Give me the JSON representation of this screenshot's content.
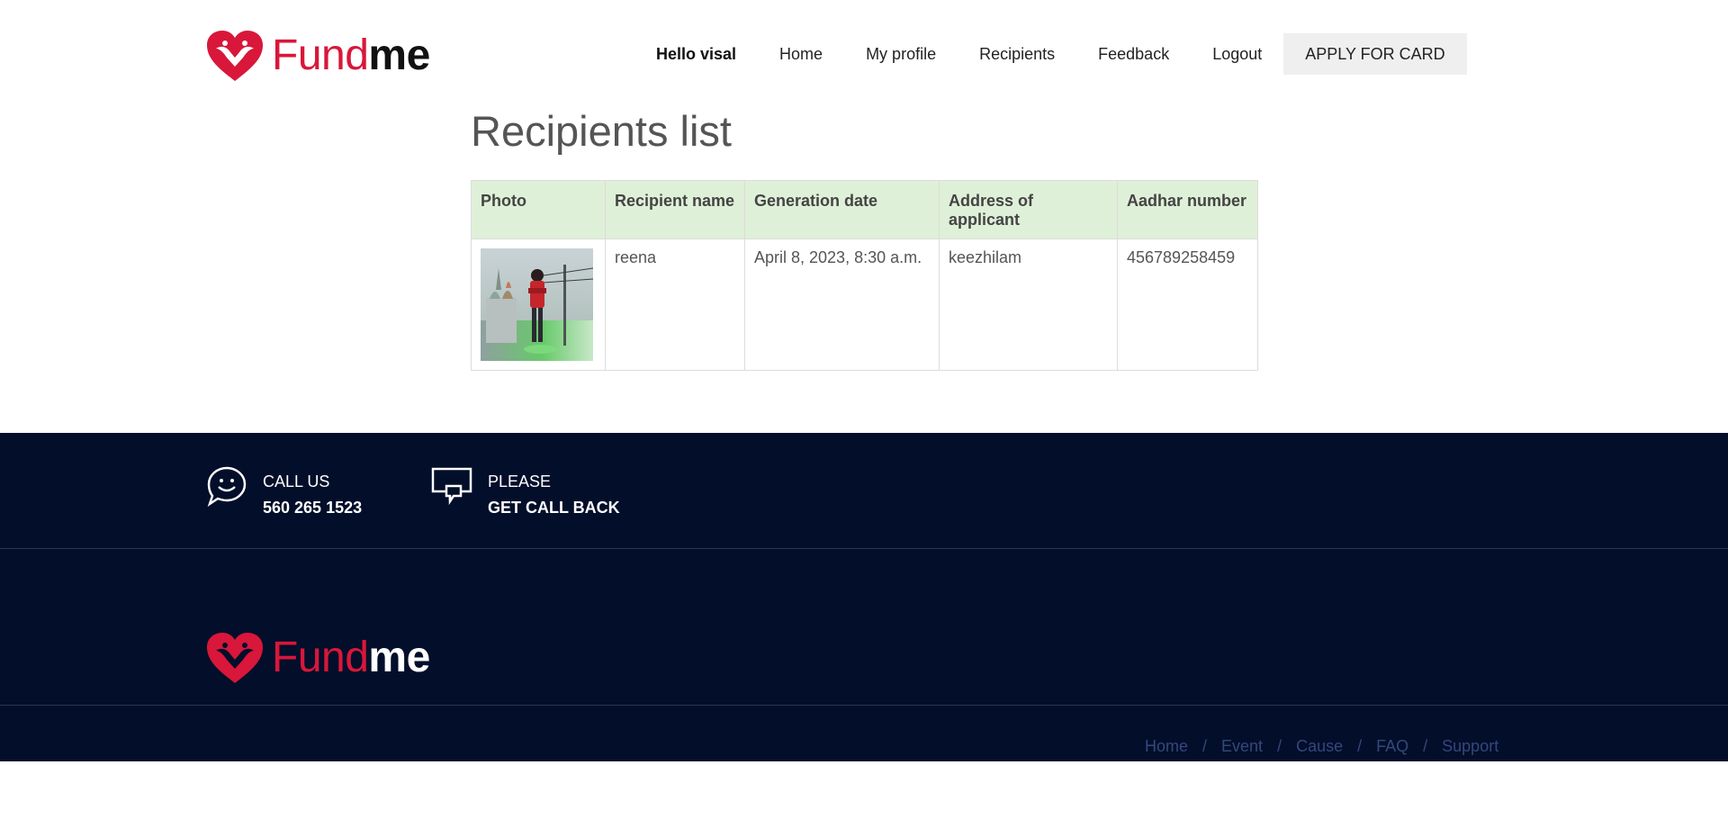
{
  "brand": {
    "name_part1": "Fund",
    "name_part2": "me"
  },
  "nav": {
    "greeting": "Hello visal",
    "items": [
      {
        "label": "Home"
      },
      {
        "label": "My profile"
      },
      {
        "label": "Recipients"
      },
      {
        "label": "Feedback"
      },
      {
        "label": "Logout"
      }
    ],
    "apply_label": "APPLY FOR CARD"
  },
  "main": {
    "title": "Recipients list",
    "table": {
      "headers": [
        "Photo",
        "Recipient name",
        "Generation date",
        "Address of applicant",
        "Aadhar number"
      ],
      "rows": [
        {
          "recipient_name": "reena",
          "generation_date": "April 8, 2023, 8:30 a.m.",
          "address": "keezhilam",
          "aadhar": "456789258459"
        }
      ]
    }
  },
  "footer": {
    "call": {
      "line1": "CALL US",
      "line2": "560 265 1523"
    },
    "callback": {
      "line1": "PLEASE",
      "line2": "GET CALL BACK"
    },
    "links": [
      "Home",
      "Event",
      "Cause",
      "FAQ",
      "Support"
    ],
    "separator": "/"
  },
  "colors": {
    "brand_red": "#d8173a",
    "footer_bg": "#030e2a",
    "table_header_bg": "#dff0d8",
    "footer_link": "#34477e"
  }
}
